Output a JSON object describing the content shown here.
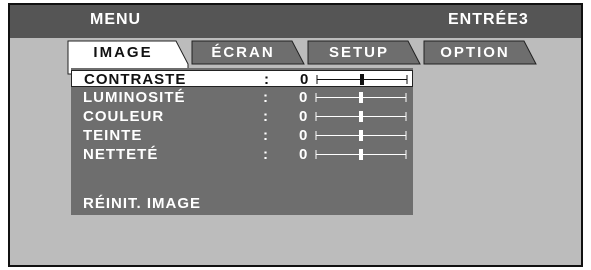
{
  "menu": {
    "title": "MENU",
    "source": "ENTRÉE3"
  },
  "tabs": [
    {
      "label": "IMAGE",
      "active": true
    },
    {
      "label": "ÉCRAN",
      "active": false
    },
    {
      "label": "SETUP",
      "active": false
    },
    {
      "label": "OPTION",
      "active": false
    }
  ],
  "image_menu": {
    "items": [
      {
        "label": "CONTRASTE",
        "separator": ":",
        "value": "0",
        "level": 0.5,
        "selected": true
      },
      {
        "label": "LUMINOSITÉ",
        "separator": ":",
        "value": "0",
        "level": 0.5,
        "selected": false
      },
      {
        "label": "COULEUR",
        "separator": ":",
        "value": "0",
        "level": 0.5,
        "selected": false
      },
      {
        "label": "TEINTE",
        "separator": ":",
        "value": "0",
        "level": 0.5,
        "selected": false
      },
      {
        "label": "NETTETÉ",
        "separator": ":",
        "value": "0",
        "level": 0.5,
        "selected": false
      }
    ],
    "reset_label": "RÉINIT. IMAGE"
  },
  "colors": {
    "header_bar": "#555555",
    "background": "#bcbcbc",
    "panel": "#6e6e6e",
    "active_tab": "#ffffff",
    "inactive_tab": "#6e6e6e",
    "selection": "#ffffff"
  }
}
